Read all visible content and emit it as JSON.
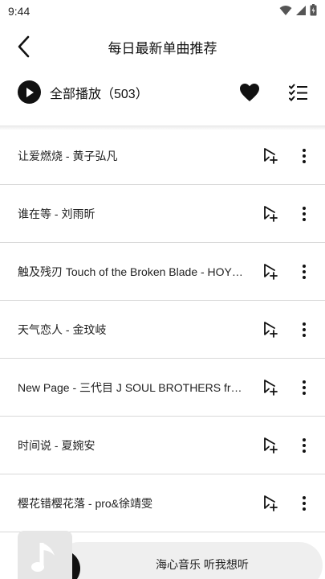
{
  "status_bar": {
    "time": "9:44",
    "icons": [
      "wifi-icon",
      "signal-icon",
      "battery-icon"
    ]
  },
  "header": {
    "back_icon": "chevron-left-icon",
    "title": "每日最新单曲推荐"
  },
  "toolbar": {
    "play_all_label": "全部播放（503）",
    "favorite_icon": "heart-icon",
    "multi_select_icon": "checklist-icon"
  },
  "songs": [
    {
      "title": "让爱燃烧 - 黄子弘凡"
    },
    {
      "title": "谁在等 - 刘雨昕"
    },
    {
      "title": "触及残刃 Touch of the Broken Blade - HOYO-MiX"
    },
    {
      "title": "天气恋人 - 金玟岐"
    },
    {
      "title": "New Page - 三代目 J SOUL BROTHERS from EXILE TRIBE"
    },
    {
      "title": "时间说 - 夏婉安"
    },
    {
      "title": "樱花错樱花落 - pro&徐靖雯"
    }
  ],
  "mini_player": {
    "text": "海心音乐 听我想听",
    "cover_icon": "music-note-icon"
  },
  "colors": {
    "accent": "#111111",
    "divider": "#d8d8d8",
    "mini_player_bg": "#efefef"
  }
}
